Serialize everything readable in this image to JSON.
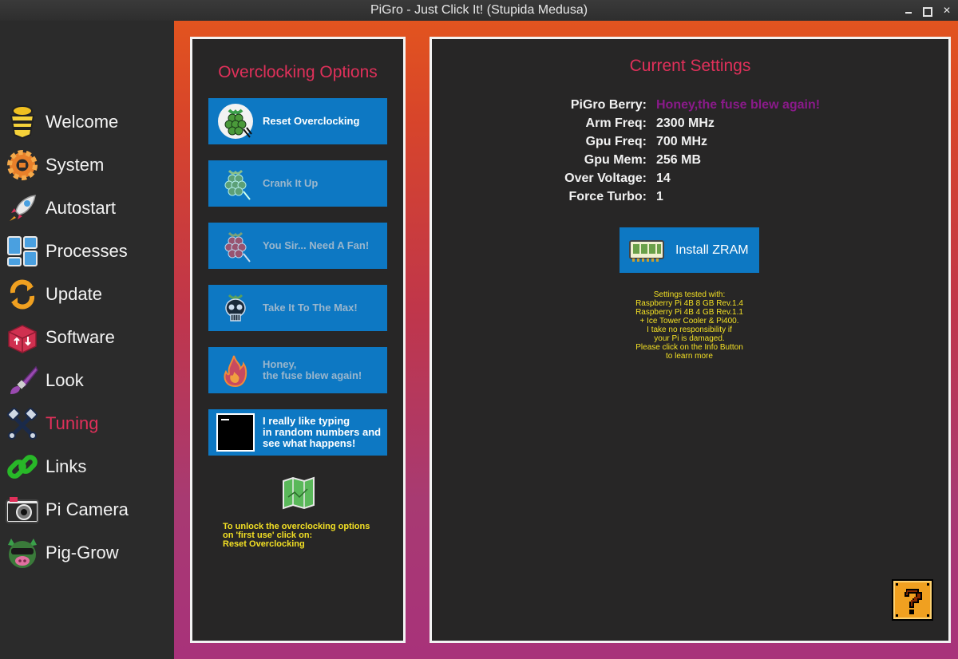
{
  "window": {
    "title": "PiGro - Just Click It! (Stupida Medusa)"
  },
  "sidebar": {
    "items": [
      {
        "label": "Welcome",
        "icon": "bee-icon"
      },
      {
        "label": "System",
        "icon": "gear-icon"
      },
      {
        "label": "Autostart",
        "icon": "rocket-icon"
      },
      {
        "label": "Processes",
        "icon": "windows-grid-icon"
      },
      {
        "label": "Update",
        "icon": "refresh-icon"
      },
      {
        "label": "Software",
        "icon": "package-icon"
      },
      {
        "label": "Look",
        "icon": "paintbrush-icon"
      },
      {
        "label": "Tuning",
        "icon": "pistons-icon",
        "active": true
      },
      {
        "label": "Links",
        "icon": "chain-link-icon"
      },
      {
        "label": "Pi Camera",
        "icon": "camera-icon"
      },
      {
        "label": "Pig-Grow",
        "icon": "pig-icon"
      }
    ]
  },
  "overclocking": {
    "title": "Overclocking Options",
    "buttons": [
      {
        "label": "Reset Overclocking",
        "icon": "raspberry-reset-icon"
      },
      {
        "label": "Crank It Up",
        "icon": "raspberry-green-icon"
      },
      {
        "label": "You Sir... Need A Fan!",
        "icon": "raspberry-red-icon"
      },
      {
        "label": "Take It To The Max!",
        "icon": "skull-raspberry-icon"
      },
      {
        "label": "Honey,\nthe fuse blew again!",
        "icon": "flame-raspberry-icon"
      },
      {
        "label": "I really like typing\nin random numbers and\nsee what happens!",
        "icon": "terminal-icon"
      }
    ],
    "map_icon": "map-icon",
    "note": "To unlock the overclocking options\non 'first use' click on:\nReset Overclocking"
  },
  "current_settings": {
    "title": "Current Settings",
    "rows": [
      {
        "key": "PiGro Berry:",
        "value": "Honey,the fuse blew again!"
      },
      {
        "key": "Arm Freq:",
        "value": "2300 MHz"
      },
      {
        "key": "Gpu Freq:",
        "value": "700 MHz"
      },
      {
        "key": "Gpu Mem:",
        "value": "256 MB"
      },
      {
        "key": "Over Voltage:",
        "value": "14"
      },
      {
        "key": "Force Turbo:",
        "value": "1"
      }
    ],
    "zram_button": "Install ZRAM",
    "tested_note": "Settings tested with:\nRaspberry Pi 4B 8 GB Rev.1.4\nRaspberry Pi 4B 4 GB Rev.1.1\n+ Ice Tower Cooler & Pi400.\nI take no responsibility if\nyour Pi is damaged.\nPlease click on the Info Button\nto learn more",
    "info_icon": "question-block-icon"
  },
  "colors": {
    "accent_red": "#e0305a",
    "button_blue": "#0d78c3",
    "note_yellow": "#f3e024",
    "berry_purple": "#8a1a8a"
  }
}
